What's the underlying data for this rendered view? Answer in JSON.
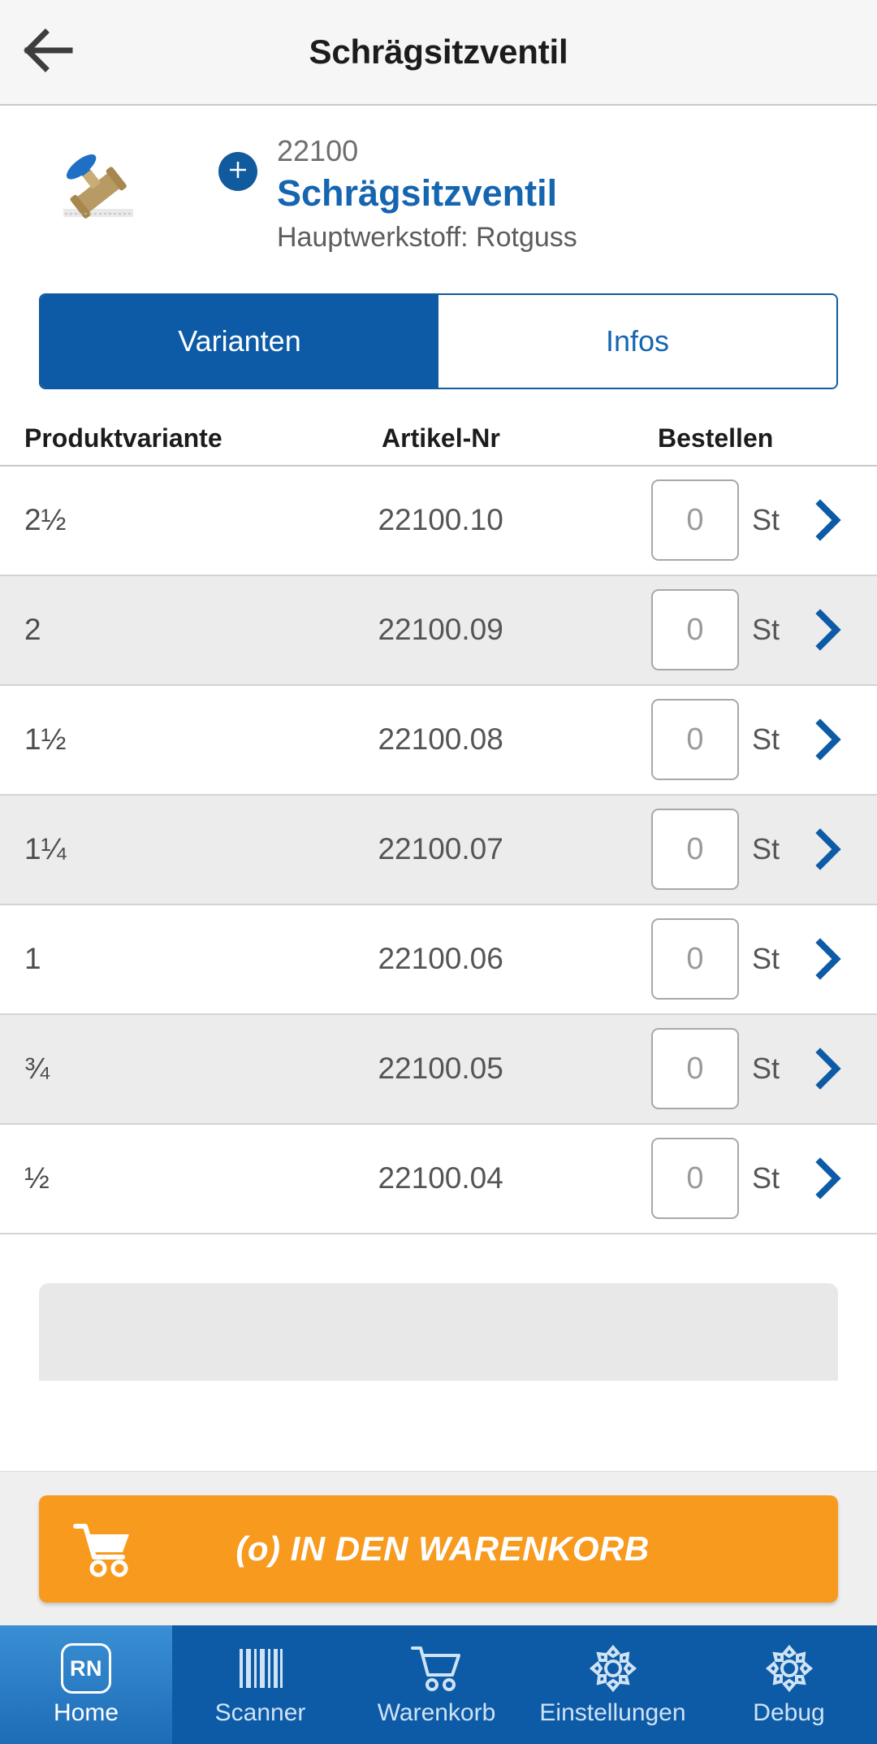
{
  "header": {
    "title": "Schrägsitzventil",
    "back_icon": "arrow-left-icon"
  },
  "product": {
    "number": "22100",
    "name": "Schrägsitzventil",
    "material": "Hauptwerkstoff: Rotguss",
    "add_icon": "plus-icon",
    "image_alt": "valve-product-image"
  },
  "tabs": [
    {
      "label": "Varianten",
      "active": true
    },
    {
      "label": "Infos",
      "active": false
    }
  ],
  "table": {
    "columns": [
      "Produktvariante",
      "Artikel-Nr",
      "Bestellen"
    ],
    "unit": "St",
    "qty_placeholder": "0",
    "rows": [
      {
        "variant": "2½",
        "article": "22100.10",
        "qty": ""
      },
      {
        "variant": "2",
        "article": "22100.09",
        "qty": ""
      },
      {
        "variant": "1½",
        "article": "22100.08",
        "qty": ""
      },
      {
        "variant": "1¼",
        "article": "22100.07",
        "qty": ""
      },
      {
        "variant": "1",
        "article": "22100.06",
        "qty": ""
      },
      {
        "variant": "¾",
        "article": "22100.05",
        "qty": ""
      },
      {
        "variant": "½",
        "article": "22100.04",
        "qty": ""
      }
    ]
  },
  "cart_button": {
    "label": "(o) IN DEN WARENKORB",
    "icon": "shopping-cart-icon",
    "color": "#f79a1e"
  },
  "bottom_nav": [
    {
      "label": "Home",
      "icon": "rn-logo-icon",
      "badge": "RN",
      "active": true
    },
    {
      "label": "Scanner",
      "icon": "barcode-icon",
      "active": false
    },
    {
      "label": "Warenkorb",
      "icon": "shopping-cart-icon",
      "active": false
    },
    {
      "label": "Einstellungen",
      "icon": "gear-icon",
      "active": false
    },
    {
      "label": "Debug",
      "icon": "gear-icon",
      "active": false
    }
  ],
  "colors": {
    "brand_blue": "#0d5ba6",
    "link_blue": "#1565b0",
    "accent_orange": "#f79a1e",
    "row_alt": "#ececec"
  }
}
